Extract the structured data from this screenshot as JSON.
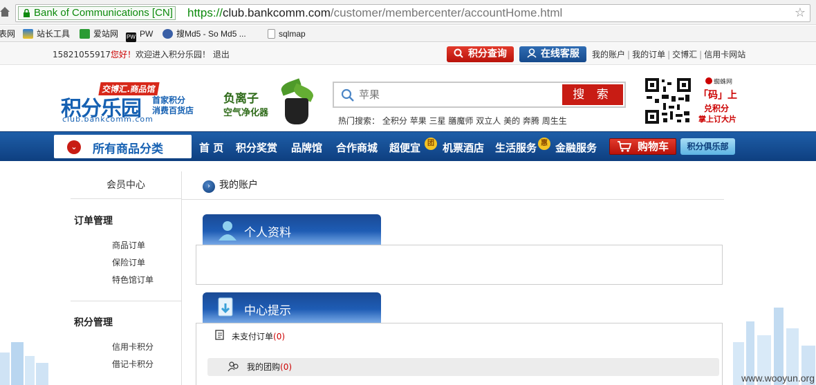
{
  "browser": {
    "cert_label": "Bank of Communications [CN]",
    "url_scheme": "https://",
    "url_host": "club.bankcomm.com",
    "url_path": "/customer/membercenter/accountHome.html",
    "bookmarks": [
      {
        "label": "表网"
      },
      {
        "label": "站长工具"
      },
      {
        "label": "爱站网"
      },
      {
        "label": "PW"
      },
      {
        "label": "搜Md5 - So Md5 ..."
      },
      {
        "label": "sqlmap"
      }
    ]
  },
  "topbar": {
    "user": "15821055917",
    "hi": "您好！",
    "welcome": "欢迎进入积分乐园！",
    "logout": "退出",
    "points_query": "积分查询",
    "online_service": "在线客服",
    "links": [
      "我的账户",
      "我的订单",
      "交博汇",
      "信用卡网站"
    ]
  },
  "header": {
    "logo_tag": "交博汇.商品馆",
    "logo_main": "积分乐园",
    "logo_slogan_1": "首家积分",
    "logo_slogan_2": "消费百货店",
    "logo_domain": "club.bankcomm.com",
    "ad_title": "负离子",
    "ad_sub": "空气净化器",
    "search_placeholder": "苹果",
    "search_button": "搜 索",
    "hot_label": "热门搜索：",
    "hot_terms": [
      "全积分",
      "苹果",
      "三星",
      "膳魔师",
      "双立人",
      "美的",
      "奔腾",
      "周生生"
    ],
    "promo_brand": "蜘蛛网",
    "promo_l1": "「码」上",
    "promo_l2": "兑积分",
    "promo_l3": "掌上订大片"
  },
  "nav": {
    "all_categories": "所有商品分类",
    "items": [
      "首 页",
      "积分奖赏",
      "品牌馆",
      "合作商城",
      "超便宜",
      "机票酒店",
      "生活服务",
      "金融服务"
    ],
    "badge_tuan": "团",
    "badge_hui": "惠",
    "cart": "购物车",
    "club": "积分俱乐部"
  },
  "sidebar": {
    "title": "会员中心",
    "sections": [
      {
        "title": "订单管理",
        "links": [
          "商品订单",
          "保险订单",
          "特色馆订单"
        ]
      },
      {
        "title": "积分管理",
        "links": [
          "信用卡积分",
          "借记卡积分"
        ]
      }
    ]
  },
  "main": {
    "breadcrumb": "我的账户",
    "profile_tab": "个人资料",
    "notice_tab": "中心提示",
    "unpaid_label": "未支付订单",
    "unpaid_count": "(0)",
    "group_label": "我的团购",
    "group_count": "(0)"
  },
  "watermark": "www.wooyun.org",
  "colors": {
    "brand_blue": "#1560b2",
    "brand_red": "#c81c14",
    "nav_bg": "#164a8c"
  }
}
